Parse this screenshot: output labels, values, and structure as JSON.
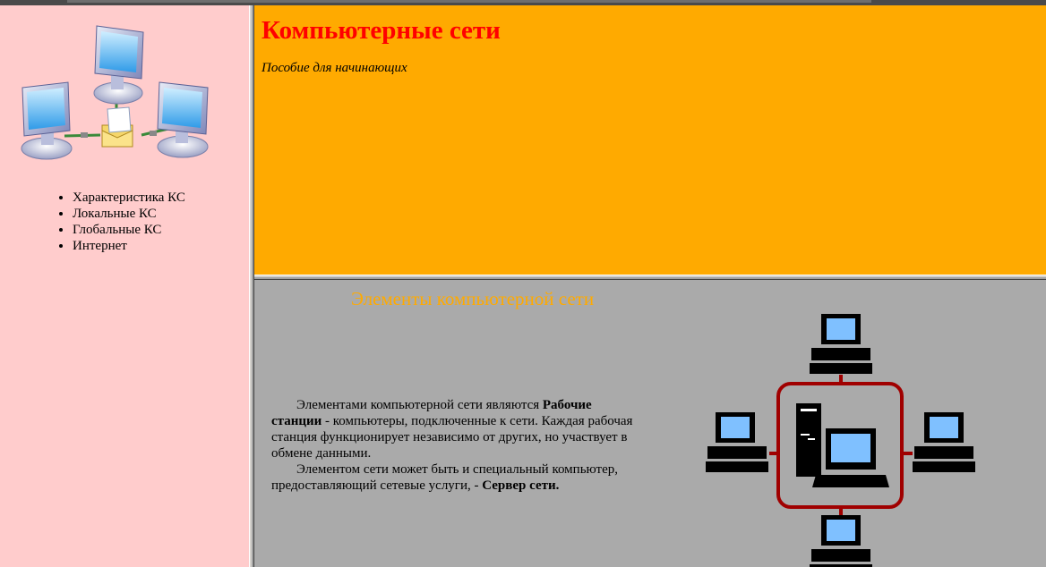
{
  "nav": {
    "items": [
      {
        "label": "Характеристика КС"
      },
      {
        "label": "Локальные КС"
      },
      {
        "label": "Глобальные КС"
      },
      {
        "label": "Интернет"
      }
    ]
  },
  "header": {
    "title": "Компьютерные сети",
    "subtitle": "Пособие для начинающих"
  },
  "main": {
    "heading": "Элементы компьютерной сети",
    "p1_a": "Элементами компьютерной сети являются ",
    "p1_b": "Рабочие станции",
    "p1_c": " - компьютеры, подключенные к сети. Каждая рабочая станция функционирует независимо от других, но участвует в обмене данными.",
    "p2_a": "Элементом сети может быть и специальный компьютер, предоставляющий сетевые услуги, - ",
    "p2_b": "Сервер сети."
  },
  "colors": {
    "left_bg": "#ffcccc",
    "header_bg": "#ffaa00",
    "title": "#ff0000",
    "main_bg": "#aaaaaa",
    "heading": "#ffaa00",
    "network_ring": "#a00000"
  },
  "icons": {
    "logo": "networked-computers-icon",
    "diagram": "network-topology-icon"
  }
}
